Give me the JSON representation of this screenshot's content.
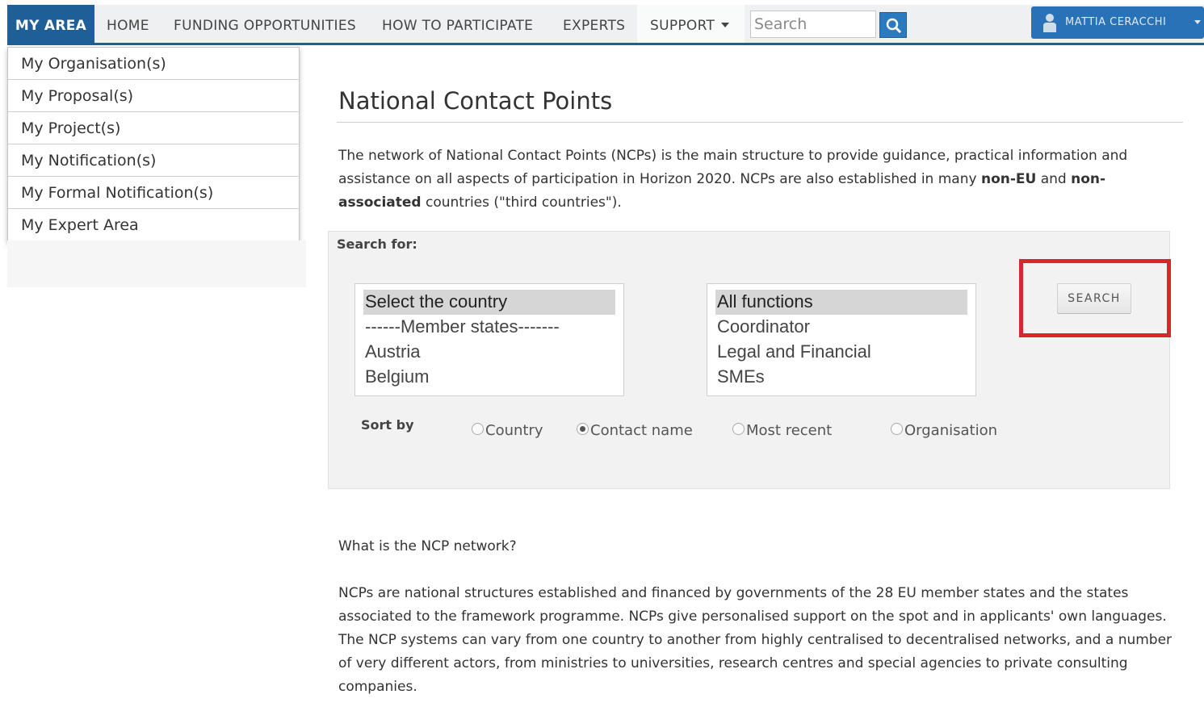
{
  "nav": {
    "my_area": "MY AREA",
    "home": "HOME",
    "funding": "FUNDING OPPORTUNITIES",
    "how": "HOW TO PARTICIPATE",
    "experts": "EXPERTS",
    "support": "SUPPORT",
    "search_placeholder": "Search",
    "user_name": "MATTIA CERACCHI"
  },
  "dropdown": {
    "items": [
      {
        "label": "My Organisation(s)"
      },
      {
        "label": "My Proposal(s)"
      },
      {
        "label": "My Project(s)"
      },
      {
        "label": "My Notification(s)"
      },
      {
        "label": "My Formal Notification(s)"
      },
      {
        "label": "My Expert Area"
      }
    ]
  },
  "main": {
    "title": "National Contact Points",
    "intro_1": "The network of National Contact Points (NCPs) is the main structure to provide guidance, practical information and assistance on all aspects of participation in Horizon 2020. NCPs are also established in many ",
    "intro_bold_1": "non-EU",
    "intro_2": " and ",
    "intro_bold_2": "non-associated",
    "intro_3": " countries (\"third countries\")."
  },
  "search_panel": {
    "label": "Search for:",
    "country_options": [
      "Select the country",
      "------Member states-------",
      "Austria",
      "Belgium"
    ],
    "function_options": [
      "All functions",
      "Coordinator",
      "Legal and Financial",
      "SMEs"
    ],
    "search_button": "SEARCH",
    "sort_label": "Sort by",
    "sort_options": [
      "Country",
      "Contact name",
      "Most recent",
      "Organisation"
    ],
    "sort_selected": "Contact name"
  },
  "info": {
    "question": "What is the NCP network?",
    "body": "NCPs are national structures established and financed by governments of the 28 EU member states and the states associated to the framework programme. NCPs give personalised support on the spot and in applicants' own languages. The NCP systems can vary from one country to another from highly centralised to decentralised networks, and a number of very different actors, from ministries to universities, research centres and special agencies to private consulting companies."
  },
  "colors": {
    "nav_accent": "#1f5f98",
    "highlight": "#d8262e"
  }
}
